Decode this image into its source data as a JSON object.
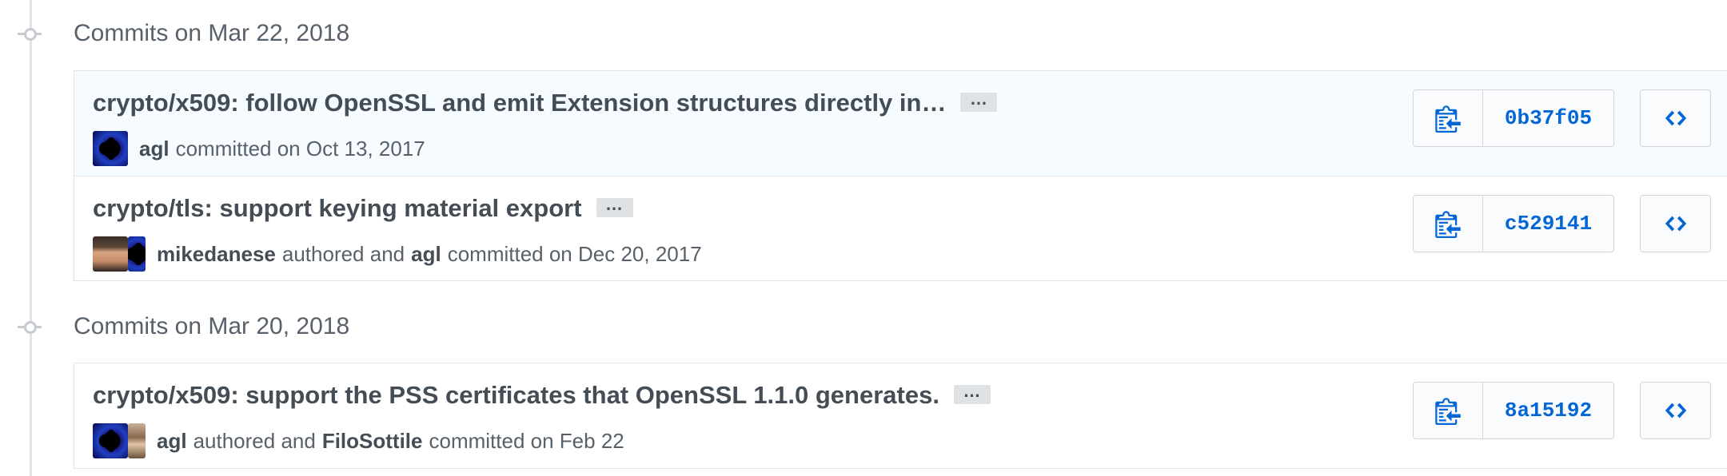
{
  "groups": [
    {
      "title": "Commits on Mar 22, 2018",
      "commits": [
        {
          "title": "crypto/x509: follow OpenSSL and emit Extension structures directly in…",
          "ellipsis": "…",
          "author": "agl",
          "committer": "",
          "meta_authored": "",
          "meta_committed": "committed on Oct 13, 2017",
          "sha": "0b37f05",
          "avatars": [
            "agl-avatar"
          ]
        },
        {
          "title": "crypto/tls: support keying material export",
          "ellipsis": "…",
          "author": "mikedanese",
          "committer": "agl",
          "meta_authored": "authored and",
          "meta_committed": "committed on Dec 20, 2017",
          "sha": "c529141",
          "avatars": [
            "mikedanese-avatar",
            "agl-avatar"
          ]
        }
      ]
    },
    {
      "title": "Commits on Mar 20, 2018",
      "commits": [
        {
          "title": "crypto/x509: support the PSS certificates that OpenSSL 1.1.0 generates.",
          "ellipsis": "…",
          "author": "agl",
          "committer": "FiloSottile",
          "meta_authored": "authored and",
          "meta_committed": "committed on Feb 22",
          "sha": "8a15192",
          "avatars": [
            "agl-avatar",
            "filosottile-avatar"
          ]
        }
      ]
    }
  ],
  "icons": {
    "copy": "clippy-icon",
    "browse": "code-icon",
    "group": "git-commit-icon"
  },
  "colors": {
    "link": "#0366d6",
    "highlight_row": "#f6fbff",
    "border": "#e1e4e8"
  }
}
